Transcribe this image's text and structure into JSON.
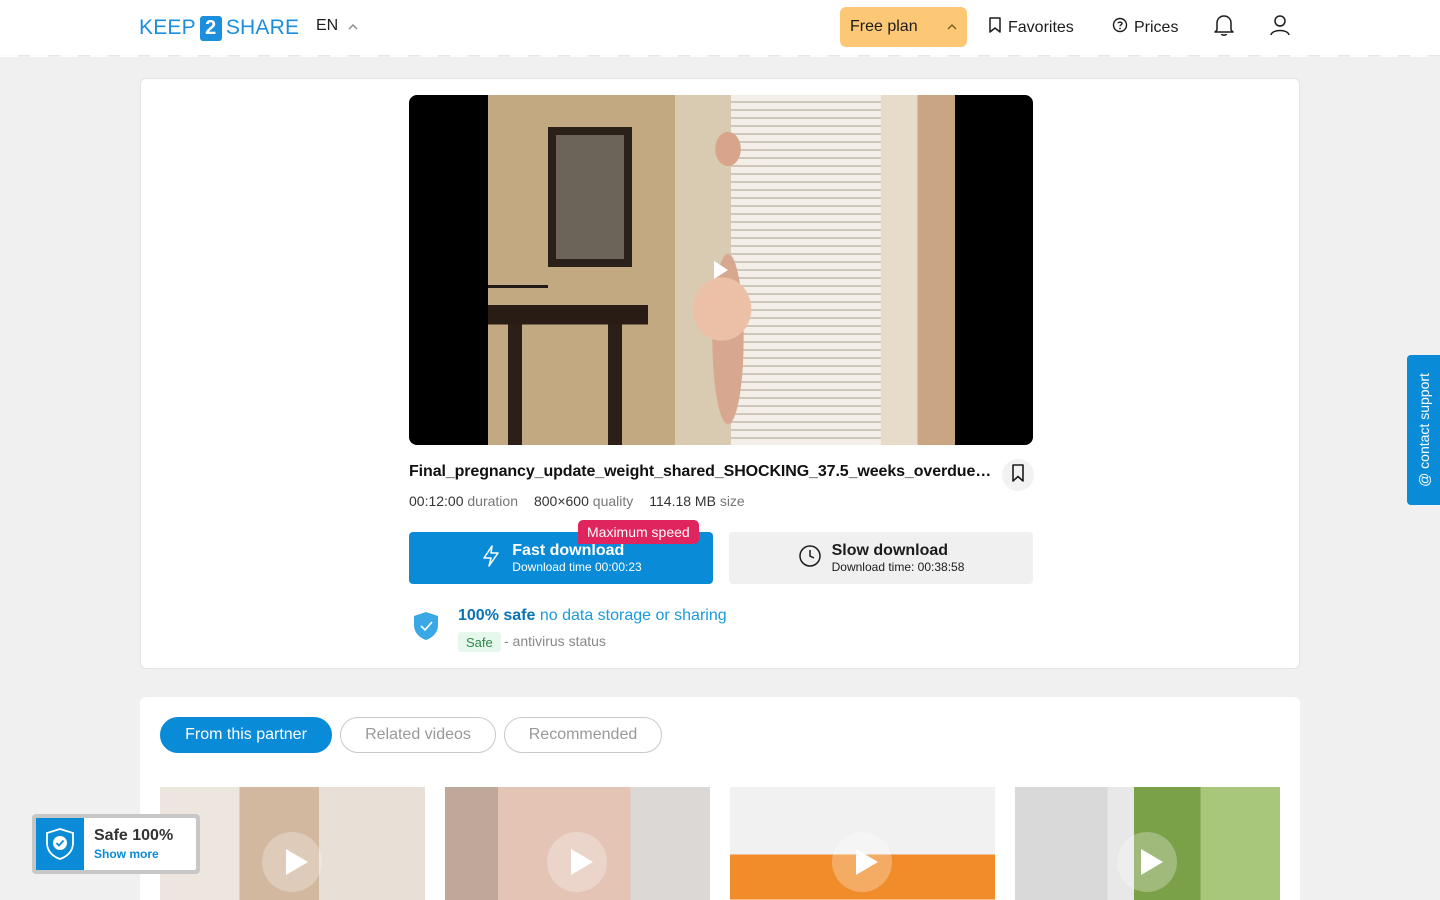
{
  "header": {
    "logo": {
      "left": "KEEP",
      "mid": "2",
      "right": "SHARE"
    },
    "language": "EN",
    "plan_label": "Free plan",
    "favorites_label": "Favorites",
    "prices_label": "Prices"
  },
  "file": {
    "name": "Final_pregnancy_update_weight_shared_SHOCKING_37.5_weeks_overdue_s_...",
    "duration_value": "00:12:00",
    "duration_label": "duration",
    "quality_value": "800×600",
    "quality_label": "quality",
    "size_value": "114.18 MB",
    "size_label": "size"
  },
  "download": {
    "badge": "Maximum speed",
    "fast_title": "Fast download",
    "fast_sub": "Download time 00:00:23",
    "slow_title": "Slow download",
    "slow_sub": "Download time: 00:38:58"
  },
  "safety": {
    "strong": "100% safe",
    "light": "no data storage or sharing",
    "tag": "Safe",
    "status": "- antivirus status"
  },
  "contact_label": "@ contact support",
  "tabs": [
    "From this partner",
    "Related videos",
    "Recommended"
  ],
  "active_tab": "From this partner",
  "safe_badge": {
    "title": "Safe 100%",
    "link": "Show more"
  },
  "colors": {
    "brand": "#0a8bd8",
    "plan": "#fdc876",
    "badge": "#e0245e",
    "safe_green": "#2c8a4a"
  },
  "icons": [
    "chevron-up-icon",
    "bookmark-icon",
    "help-circle-icon",
    "bell-icon",
    "user-icon",
    "play-icon",
    "lightning-icon",
    "clock-icon",
    "shield-check-icon"
  ]
}
